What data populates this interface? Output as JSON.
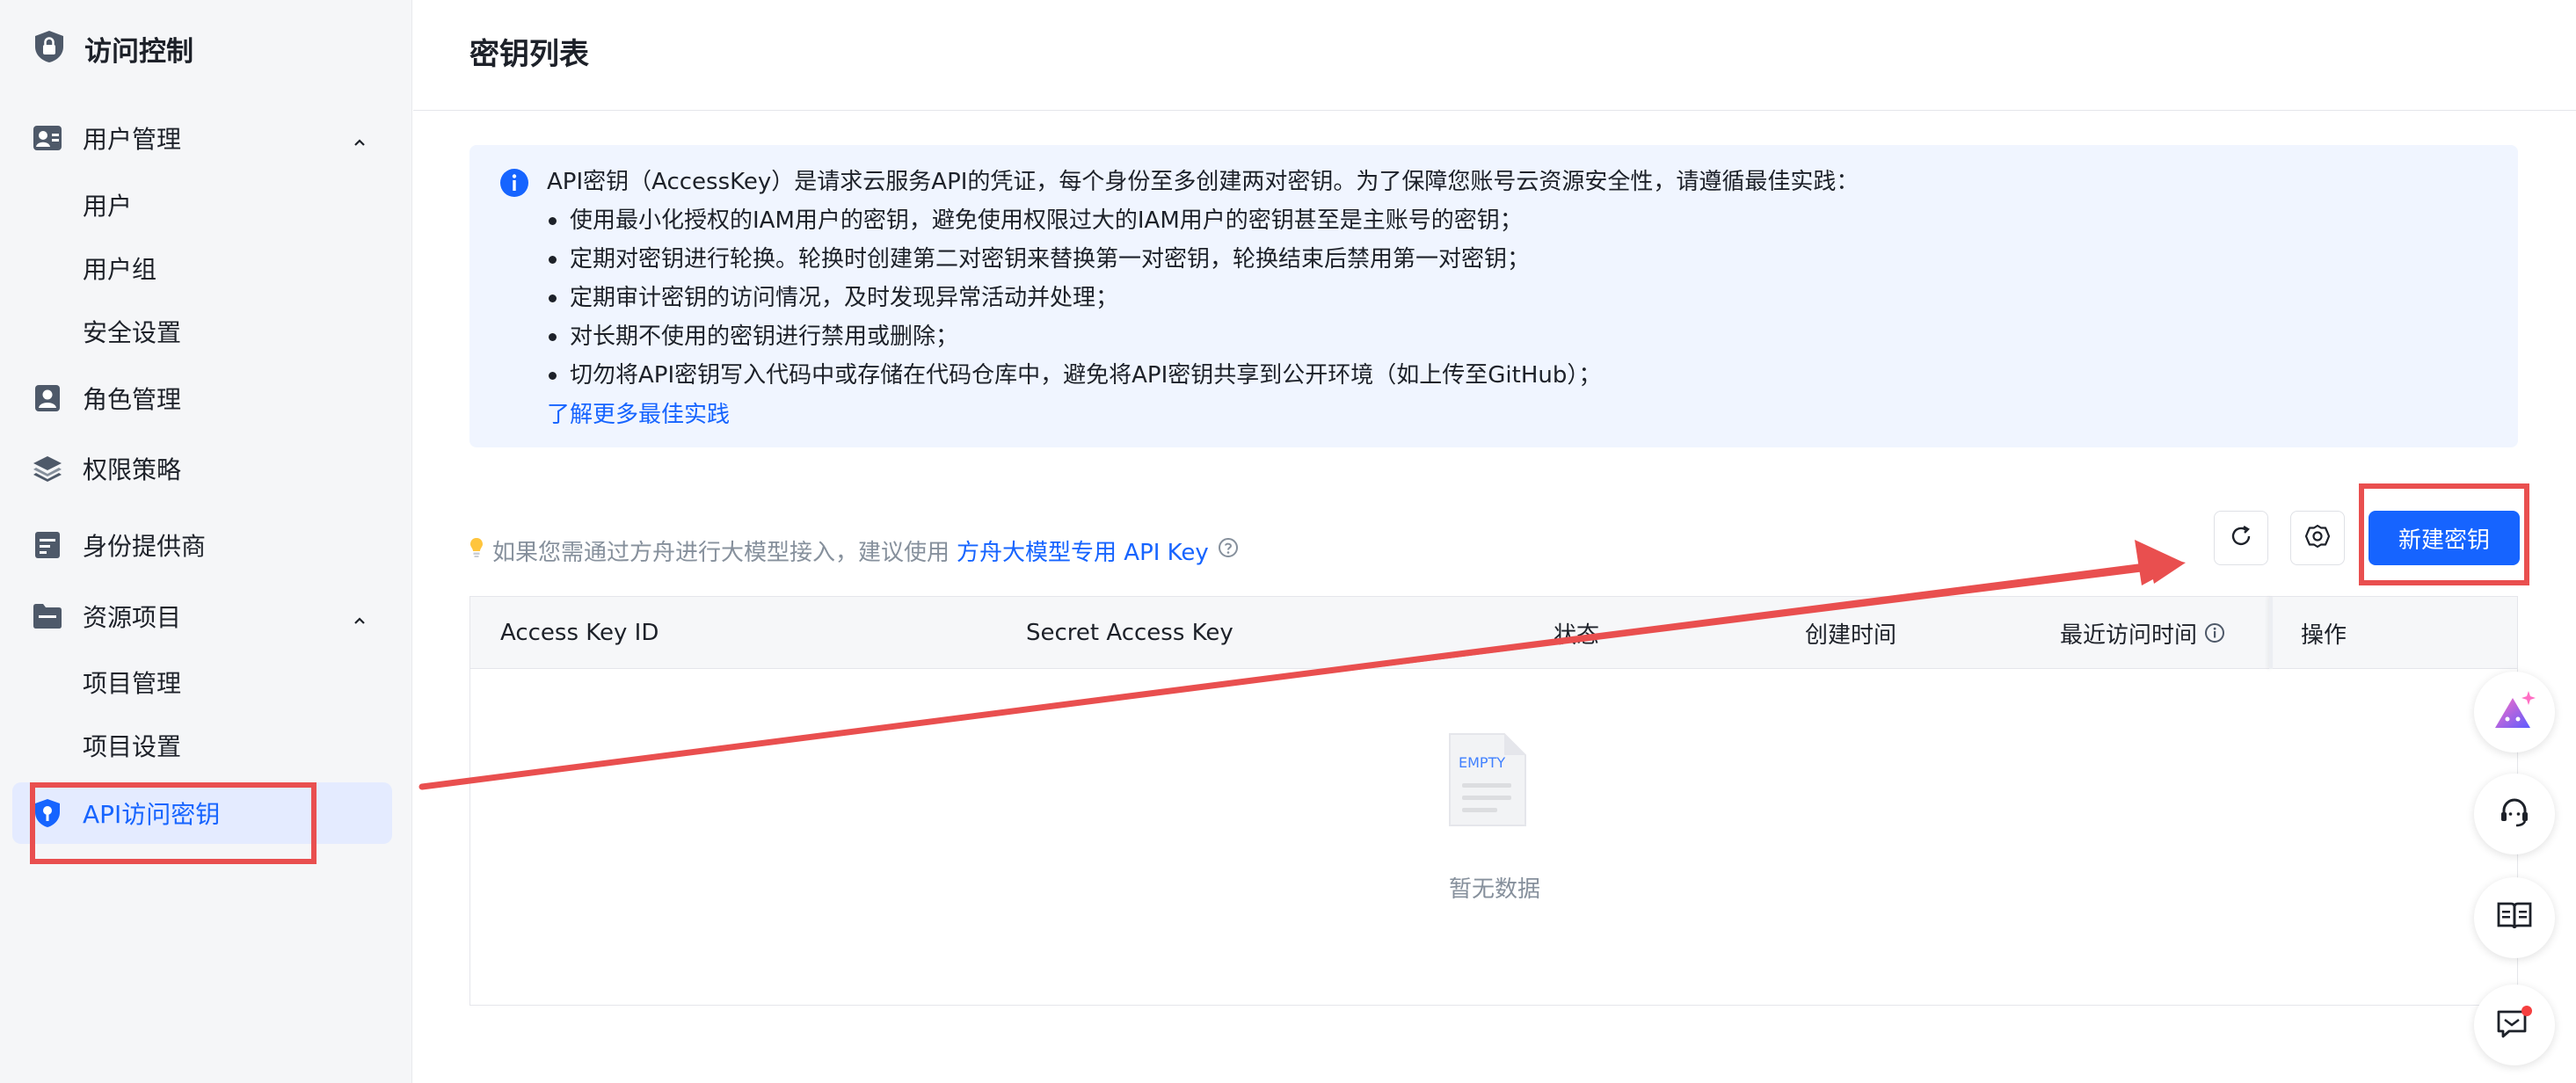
{
  "sidebar": {
    "title": "访问控制",
    "items": [
      {
        "label": "用户管理",
        "expanded": true,
        "children": [
          "用户",
          "用户组",
          "安全设置"
        ]
      },
      {
        "label": "角色管理"
      },
      {
        "label": "权限策略"
      },
      {
        "label": "身份提供商"
      },
      {
        "label": "资源项目",
        "expanded": true,
        "children": [
          "项目管理",
          "项目设置"
        ]
      },
      {
        "label": "API访问密钥",
        "active": true
      }
    ]
  },
  "header": {
    "title": "密钥列表"
  },
  "info": {
    "lead": "API密钥（AccessKey）是请求云服务API的凭证，每个身份至多创建两对密钥。为了保障您账号云资源安全性，请遵循最佳实践：",
    "bullets": [
      "使用最小化授权的IAM用户的密钥，避免使用权限过大的IAM用户的密钥甚至是主账号的密钥；",
      "定期对密钥进行轮换。轮换时创建第二对密钥来替换第一对密钥，轮换结束后禁用第一对密钥；",
      "定期审计密钥的访问情况，及时发现异常活动并处理；",
      "对长期不使用的密钥进行禁用或删除；",
      "切勿将API密钥写入代码中或存储在代码仓库中，避免将API密钥共享到公开环境（如上传至GitHub）；"
    ],
    "more_link": "了解更多最佳实践"
  },
  "toolbar": {
    "tip_text": "如果您需通过方舟进行大模型接入，建议使用",
    "tip_link": "方舟大模型专用 API Key",
    "new_button": "新建密钥"
  },
  "table": {
    "columns": [
      "Access Key ID",
      "Secret Access Key",
      "状态",
      "创建时间",
      "最近访问时间",
      "操作"
    ],
    "rows": [],
    "empty_label": "EMPTY",
    "empty_text": "暂无数据"
  },
  "colors": {
    "accent": "#1664ff",
    "annotation": "#e94f4f",
    "active_bg": "#e4ebff"
  },
  "icons": {
    "refresh": "refresh-icon",
    "settings": "gear-icon",
    "fab": [
      "ai-assistant-icon",
      "customer-service-icon",
      "docs-book-icon",
      "feedback-icon"
    ]
  }
}
